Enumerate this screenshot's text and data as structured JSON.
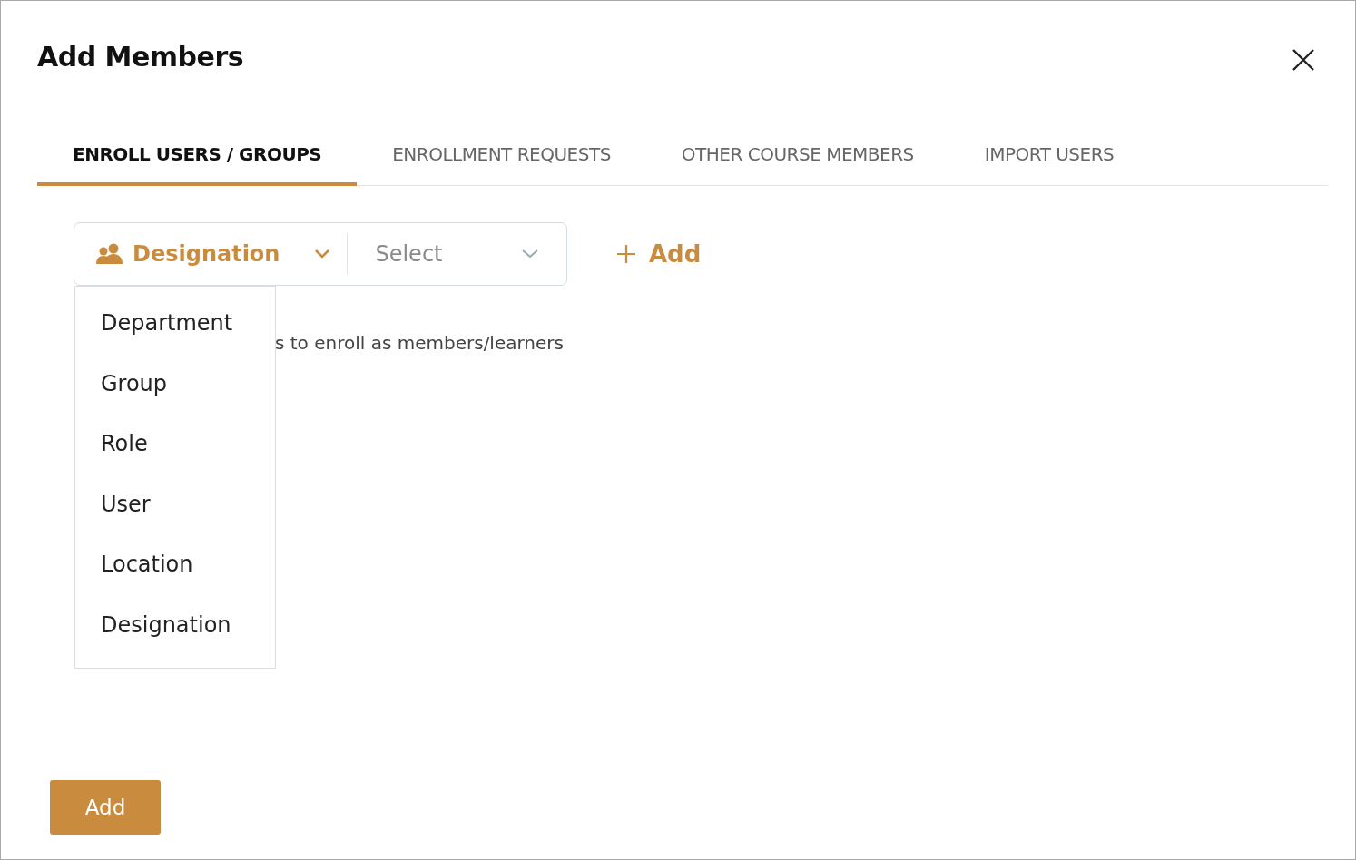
{
  "dialog": {
    "title": "Add Members"
  },
  "tabs": [
    {
      "label": "ENROLL USERS / GROUPS",
      "selected": true
    },
    {
      "label": "ENROLLMENT REQUESTS",
      "selected": false
    },
    {
      "label": "OTHER COURSE MEMBERS",
      "selected": false
    },
    {
      "label": "IMPORT USERS",
      "selected": false
    }
  ],
  "type_select": {
    "value": "Designation",
    "expanded": true
  },
  "value_select": {
    "placeholder": "Select"
  },
  "add_link": "Add",
  "hint": "s to enroll as members/learners",
  "menu_items": [
    {
      "label": "Department"
    },
    {
      "label": "Group"
    },
    {
      "label": "Role"
    },
    {
      "label": "User"
    },
    {
      "label": "Location"
    },
    {
      "label": "Designation"
    }
  ],
  "footer_button": "Add"
}
